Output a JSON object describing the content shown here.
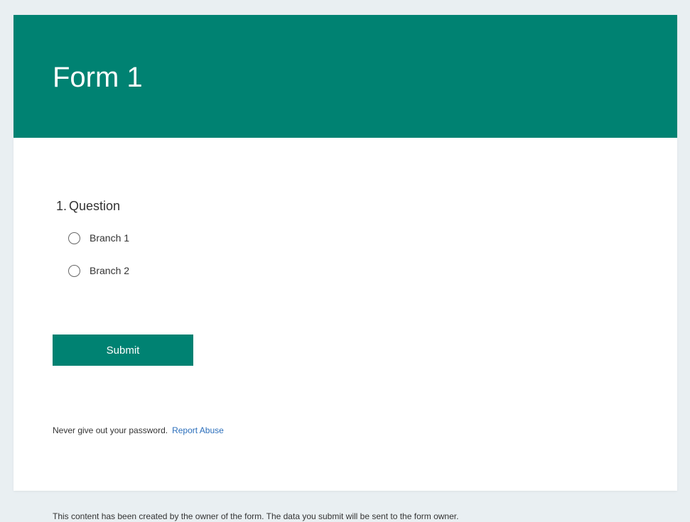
{
  "form": {
    "title": "Form 1",
    "header_color": "#008272"
  },
  "question": {
    "number": "1.",
    "text": "Question",
    "options": [
      {
        "label": "Branch 1",
        "selected": false
      },
      {
        "label": "Branch 2",
        "selected": false
      }
    ]
  },
  "submit": {
    "label": "Submit"
  },
  "footer": {
    "note": "Never give out your password.",
    "report_link": "Report Abuse"
  },
  "disclaimer": {
    "text": "This content has been created by the owner of the form. The data you submit will be sent to the form owner."
  },
  "colors": {
    "accent": "#008272",
    "link": "#2a6ebb",
    "page_background": "#e9eff2"
  }
}
